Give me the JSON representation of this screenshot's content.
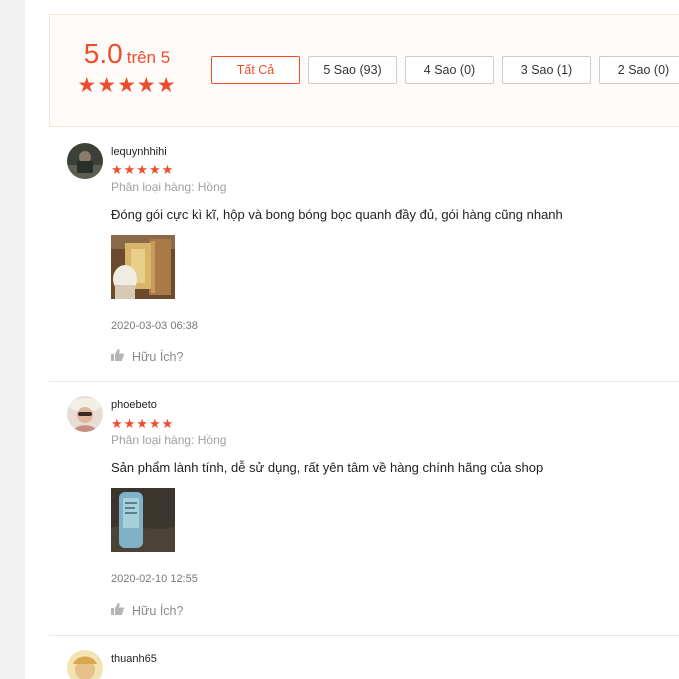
{
  "summary": {
    "score": "5.0",
    "score_suffix": "trên 5",
    "stars": "★★★★★"
  },
  "filters": [
    {
      "label": "Tất Cả",
      "active": true
    },
    {
      "label": "5 Sao (93)",
      "active": false
    },
    {
      "label": "4 Sao (0)",
      "active": false
    },
    {
      "label": "3 Sao (1)",
      "active": false
    },
    {
      "label": "2 Sao (0)",
      "active": false
    }
  ],
  "reviews": [
    {
      "username": "lequynhhihi",
      "stars": "★★★★★",
      "variant": "Phân loại hàng: Hồng",
      "comment": "Đóng gói cực kì kĩ, hộp và bong bóng bọc quanh đầy đủ, gói hàng cũng nhanh",
      "timestamp": "2020-03-03 06:38",
      "helpful": "Hữu Ích?"
    },
    {
      "username": "phoebeto",
      "stars": "★★★★★",
      "variant": "Phân loại hàng: Hồng",
      "comment": "Sản phẩm lành tính, dễ sử dụng, rất yên tâm về hàng chính hãng của shop",
      "timestamp": "2020-02-10 12:55",
      "helpful": "Hữu Ích?"
    },
    {
      "username": "thuanh65"
    }
  ],
  "colors": {
    "accent": "#ee4d2d",
    "panel_bg": "#fffbf8",
    "muted": "#a0a0a0"
  }
}
